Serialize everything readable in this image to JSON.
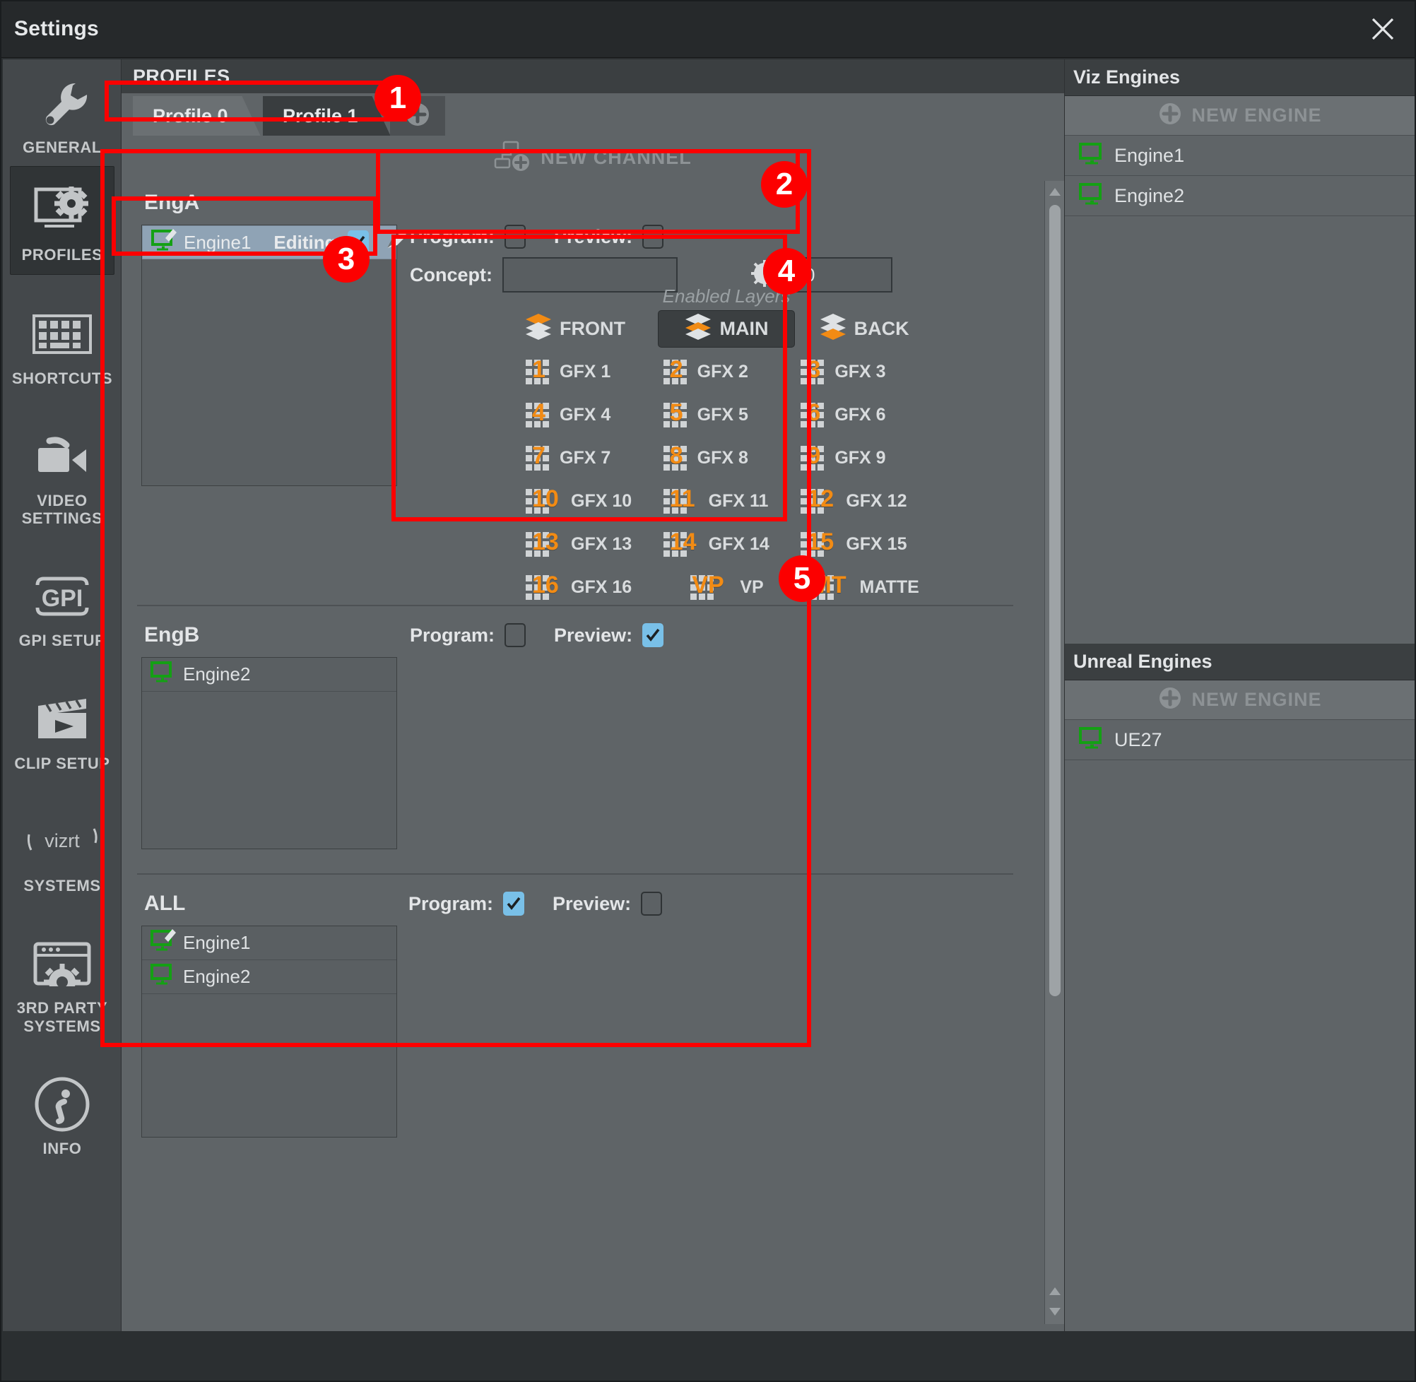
{
  "window": {
    "title": "Settings",
    "close_icon": "close-icon"
  },
  "sidebar": {
    "items": [
      {
        "label": "GENERAL",
        "icon": "wrench-icon",
        "active": false
      },
      {
        "label": "PROFILES",
        "icon": "monitor-gear-icon",
        "active": true
      },
      {
        "label": "SHORTCUTS",
        "icon": "keyboard-icon",
        "active": false
      },
      {
        "label": "VIDEO SETTINGS",
        "icon": "video-camera-icon",
        "active": false
      },
      {
        "label": "GPI SETUP",
        "icon": "gpi-icon",
        "active": false
      },
      {
        "label": "CLIP SETUP",
        "icon": "clapperboard-icon",
        "active": false
      },
      {
        "label": "SYSTEMS",
        "icon": "vizrt-logo-icon",
        "active": false
      },
      {
        "label": "3RD PARTY SYSTEMS",
        "icon": "window-gear-icon",
        "active": false
      },
      {
        "label": "INFO",
        "icon": "info-circle-icon",
        "active": false
      }
    ],
    "vizrt_wordmark": "vizrt"
  },
  "main": {
    "header": "PROFILES",
    "tabs": [
      {
        "label": "Profile 0",
        "selected": true
      },
      {
        "label": "Profile 1",
        "selected": false
      }
    ],
    "add_tab_icon": "plus-circle-icon",
    "new_channel": {
      "label": "NEW CHANNEL",
      "icon": "new-channel-icon"
    }
  },
  "channels": [
    {
      "name": "EngA",
      "program_label": "Program:",
      "program_checked": false,
      "preview_label": "Preview:",
      "preview_checked": false,
      "concept_label": "Concept:",
      "concept_value": "",
      "concept_placeholder": "",
      "clock_icon": "clock-icon",
      "delay_value": "0",
      "engines": [
        {
          "name": "Engine1",
          "icon": "monitor-edit-icon",
          "selected": true,
          "editing_label": "Editing:",
          "editing_checked": true,
          "pencil_icon": "pencil-icon"
        }
      ]
    },
    {
      "name": "EngB",
      "program_label": "Program:",
      "program_checked": false,
      "preview_label": "Preview:",
      "preview_checked": true,
      "engines": [
        {
          "name": "Engine2",
          "icon": "monitor-icon",
          "selected": false
        }
      ]
    },
    {
      "name": "ALL",
      "program_label": "Program:",
      "program_checked": true,
      "preview_label": "Preview:",
      "preview_checked": false,
      "engines": [
        {
          "name": "Engine1",
          "icon": "monitor-edit-icon",
          "selected": false
        },
        {
          "name": "Engine2",
          "icon": "monitor-icon",
          "selected": false
        }
      ]
    }
  ],
  "enabled_layers": {
    "caption": "Enabled Layers",
    "items": [
      {
        "label": "FRONT",
        "icon": "layer-front-icon",
        "badge": "",
        "active": false,
        "type": "layer"
      },
      {
        "label": "MAIN",
        "icon": "layer-main-icon",
        "badge": "",
        "active": true,
        "type": "layer"
      },
      {
        "label": "BACK",
        "icon": "layer-back-icon",
        "badge": "",
        "active": false,
        "type": "layer"
      },
      {
        "label": "GFX 1",
        "icon": "gfx-icon",
        "badge": "1",
        "active": false,
        "type": "gfx"
      },
      {
        "label": "GFX 2",
        "icon": "gfx-icon",
        "badge": "2",
        "active": false,
        "type": "gfx"
      },
      {
        "label": "GFX 3",
        "icon": "gfx-icon",
        "badge": "3",
        "active": false,
        "type": "gfx"
      },
      {
        "label": "GFX 4",
        "icon": "gfx-icon",
        "badge": "4",
        "active": false,
        "type": "gfx"
      },
      {
        "label": "GFX 5",
        "icon": "gfx-icon",
        "badge": "5",
        "active": false,
        "type": "gfx"
      },
      {
        "label": "GFX 6",
        "icon": "gfx-icon",
        "badge": "6",
        "active": false,
        "type": "gfx"
      },
      {
        "label": "GFX 7",
        "icon": "gfx-icon",
        "badge": "7",
        "active": false,
        "type": "gfx"
      },
      {
        "label": "GFX 8",
        "icon": "gfx-icon",
        "badge": "8",
        "active": false,
        "type": "gfx"
      },
      {
        "label": "GFX 9",
        "icon": "gfx-icon",
        "badge": "9",
        "active": false,
        "type": "gfx"
      },
      {
        "label": "GFX 10",
        "icon": "gfx-icon",
        "badge": "10",
        "active": false,
        "type": "gfx"
      },
      {
        "label": "GFX 11",
        "icon": "gfx-icon",
        "badge": "11",
        "active": false,
        "type": "gfx"
      },
      {
        "label": "GFX 12",
        "icon": "gfx-icon",
        "badge": "12",
        "active": false,
        "type": "gfx"
      },
      {
        "label": "GFX 13",
        "icon": "gfx-icon",
        "badge": "13",
        "active": false,
        "type": "gfx"
      },
      {
        "label": "GFX 14",
        "icon": "gfx-icon",
        "badge": "14",
        "active": false,
        "type": "gfx"
      },
      {
        "label": "GFX 15",
        "icon": "gfx-icon",
        "badge": "15",
        "active": false,
        "type": "gfx"
      },
      {
        "label": "GFX 16",
        "icon": "gfx-icon",
        "badge": "16",
        "active": false,
        "type": "gfx"
      },
      {
        "label": "VP",
        "icon": "gfx-icon",
        "badge": "VP",
        "active": false,
        "type": "gfx"
      },
      {
        "label": "MATTE",
        "icon": "gfx-icon",
        "badge": "MT",
        "active": false,
        "type": "gfx"
      }
    ]
  },
  "right_panel": {
    "sections": [
      {
        "title": "Viz Engines",
        "new_engine_label": "NEW ENGINE",
        "new_engine_icon": "plus-circle-icon",
        "engines": [
          {
            "name": "Engine1",
            "icon": "monitor-icon"
          },
          {
            "name": "Engine2",
            "icon": "monitor-icon"
          }
        ]
      },
      {
        "title": "Unreal Engines",
        "new_engine_label": "NEW ENGINE",
        "new_engine_icon": "plus-circle-icon",
        "engines": [
          {
            "name": "UE27",
            "icon": "monitor-icon"
          }
        ]
      }
    ]
  },
  "annotations": {
    "color": "#fc0000",
    "badges": [
      {
        "label": "1"
      },
      {
        "label": "2"
      },
      {
        "label": "3"
      },
      {
        "label": "4"
      },
      {
        "label": "5"
      }
    ]
  },
  "colors": {
    "accent_orange": "#f28b14",
    "checkbox_blue": "#79c0e8",
    "engine_green": "#14a014",
    "annotation_red": "#fc0000",
    "selection_blue": "#8fa3b5"
  }
}
